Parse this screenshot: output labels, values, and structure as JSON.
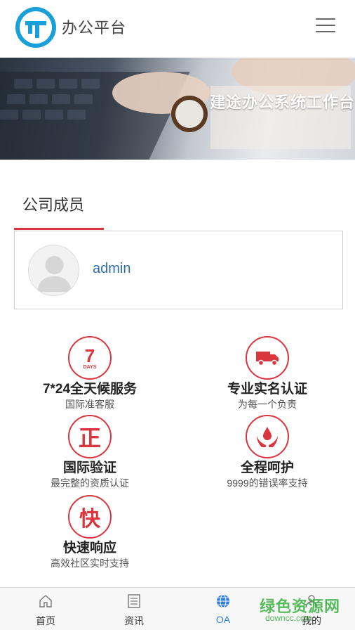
{
  "header": {
    "title": "办公平台",
    "menu_icon": "hamburger-menu-icon",
    "logo_icon": "brand-logo-icon",
    "brand_color": "#1aa0d8"
  },
  "banner": {
    "caption": "建途办公系统工作台"
  },
  "section": {
    "tab_label": "公司成员",
    "accent_color": "#d9363e"
  },
  "members": [
    {
      "name": "admin",
      "avatar_icon": "user-avatar-icon"
    }
  ],
  "features": [
    {
      "icon_text": "7",
      "icon_sub": "DAYS",
      "title": "7*24全天候服务",
      "subtitle": "国际准客服"
    },
    {
      "icon": "truck-icon",
      "title": "专业实名认证",
      "subtitle": "为每一个负责"
    },
    {
      "icon_text": "正",
      "title": "国际验证",
      "subtitle": "最完整的资质认证"
    },
    {
      "icon": "hands-drop-icon",
      "title": "全程呵护",
      "subtitle": "9999的错误率支持"
    },
    {
      "icon_text": "快",
      "title": "快速响应",
      "subtitle": "高效社区实时支持"
    }
  ],
  "tabbar": {
    "active": "OA",
    "items": [
      {
        "label": "首页",
        "icon": "home-icon"
      },
      {
        "label": "资讯",
        "icon": "news-icon"
      },
      {
        "label": "OA",
        "icon": "globe-icon"
      },
      {
        "label": "我的",
        "icon": "user-icon"
      }
    ]
  },
  "watermark": {
    "text": "绿色资源网",
    "domain": "downcc.com"
  }
}
